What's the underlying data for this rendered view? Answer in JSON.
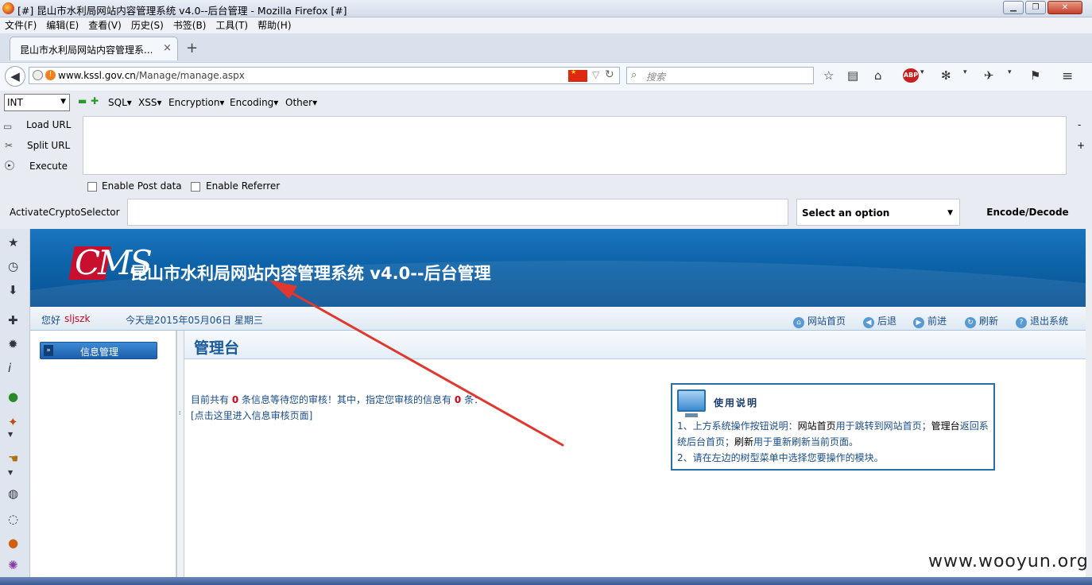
{
  "window": {
    "title": "[#] 昆山市水利局网站内容管理系统 v4.0--后台管理 - Mozilla Firefox [#]"
  },
  "menu": [
    "文件(F)",
    "编辑(E)",
    "查看(V)",
    "历史(S)",
    "书签(B)",
    "工具(T)",
    "帮助(H)"
  ],
  "tab": {
    "label": "昆山市水利局网站内容管理系...",
    "close": "×",
    "new": "+"
  },
  "nav": {
    "url_host": "www.kssl.gov.cn",
    "url_path": "/Manage/manage.aspx",
    "search_placeholder": "搜索"
  },
  "hackbar": {
    "int_value": "INT",
    "menus": [
      "SQL▾",
      "XSS▾",
      "Encryption▾",
      "Encoding▾",
      "Other▾"
    ],
    "load_url": "Load URL",
    "split_url": "Split URL",
    "execute": "Execute",
    "enable_post": "Enable Post data",
    "enable_referrer": "Enable Referrer",
    "crypto_label": "ActivateCryptoSelector",
    "select_option": "Select an option",
    "encode_decode": "Encode/Decode"
  },
  "page": {
    "logo": "CMS",
    "site_title": "昆山市水利局网站内容管理系统 v4.0--后台管理",
    "greeting": "您好",
    "username": "sljszk",
    "date": "今天是2015年05月06日 星期三",
    "nav_links": [
      "网站首页",
      "后退",
      "前进",
      "刷新",
      "退出系统"
    ],
    "tree_header": "信息管理",
    "main_title": "管理台",
    "msg_part1": "目前共有",
    "pending_count": "0",
    "msg_part2": "条信息等待您的审核！其中，指定您审核的信息有",
    "assigned_count": "0",
    "msg_part3": "条：",
    "msg_link": "[点击这里进入信息审核页面]",
    "help_title": "使用说明",
    "help_line1a": "1、上方系统操作按钮说明：",
    "help_line1b": "网站首页",
    "help_line1c": "用于跳转到网站首页；",
    "help_line1d": "管理台",
    "help_line1e": "返回系统后台首页；",
    "help_line1f": "刷新",
    "help_line1g": "用于重新刷新当前页面。",
    "help_line2": "2、请在左边的树型菜单中选择您要操作的模块。"
  },
  "watermark": "www.wooyun.org",
  "colors": {
    "banner": "#0d63a8",
    "link": "#1a4d8a",
    "alert": "#d4001e",
    "arrow": "#e0382e"
  }
}
